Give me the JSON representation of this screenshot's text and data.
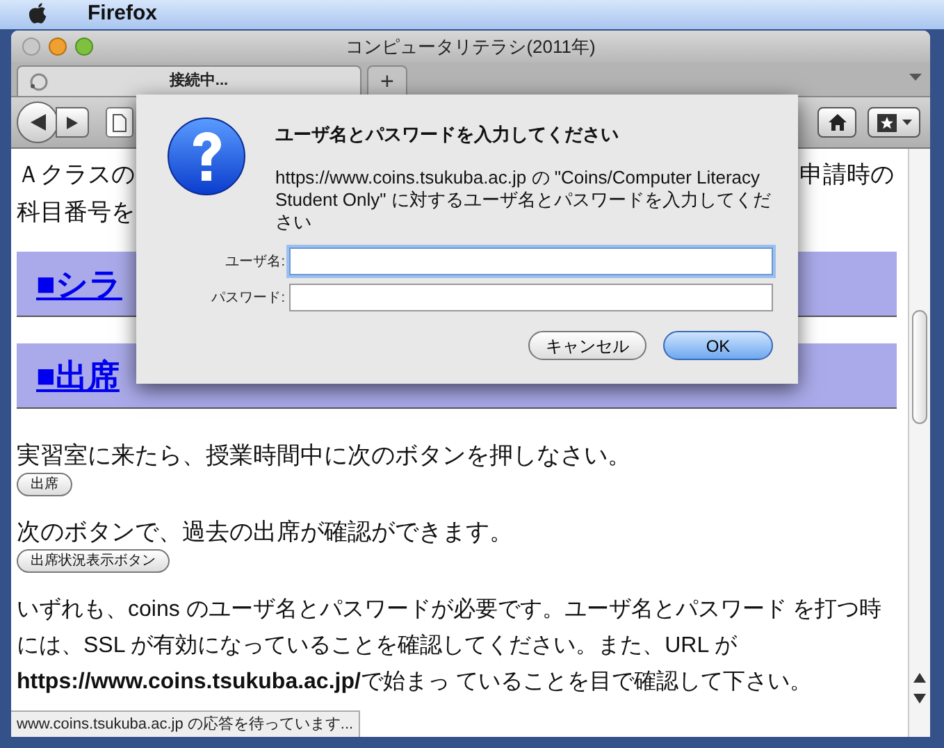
{
  "menu_bar": {
    "app": "Firefox"
  },
  "window": {
    "title": "コンピュータリテラシ(2011年)"
  },
  "tabs": [
    {
      "label": "接続中...",
      "selected": true,
      "loading": true
    }
  ],
  "new_tab_button": "+",
  "content": {
    "intro_left": [
      "Ａクラスの",
      "科目番号を"
    ],
    "intro_right": "申請時の",
    "headings": [
      "■シラ",
      "■出席"
    ],
    "sections": [
      {
        "text": "実習室に来たら、授業時間中に次のボタンを押しなさい。",
        "button": "出席"
      },
      {
        "text": "次のボタンで、過去の出席が確認ができます。",
        "button": "出席状況表示ボタン"
      }
    ],
    "note": "いずれも、coins のユーザ名とパスワードが必要です。ユーザ名とパスワード を打つ時には、SSL が有効になっていることを確認してください。また、URL が **https://www.coins.tsukuba.ac.jp/**で始まっ ていることを目で確認して下さい。"
  },
  "status_bar": "www.coins.tsukuba.ac.jp の応答を待っています...",
  "dialog": {
    "title": "ユーザ名とパスワードを入力してください",
    "message": "https://www.coins.tsukuba.ac.jp の \"Coins/Computer Literacy Student Only\" に対するユーザ名とパスワードを入力してください",
    "fields": [
      {
        "label": "ユーザ名:",
        "focused": true
      },
      {
        "label": "パスワード:",
        "focused": false
      }
    ],
    "buttons": [
      {
        "label": "キャンセル",
        "default": false
      },
      {
        "label": "OK",
        "default": true
      }
    ]
  }
}
